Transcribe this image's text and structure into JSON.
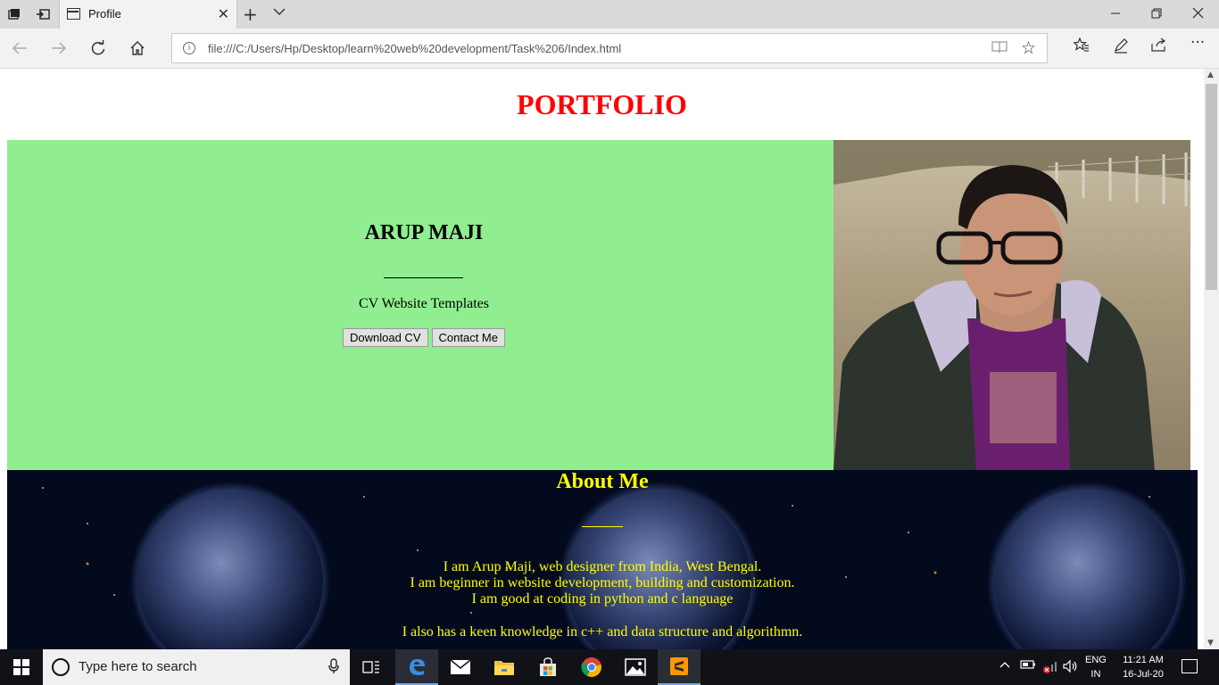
{
  "browser": {
    "tab_title": "Profile",
    "url": "file:///C:/Users/Hp/Desktop/learn%20web%20development/Task%206/Index.html",
    "window_controls": [
      "minimize",
      "restore",
      "close"
    ]
  },
  "page": {
    "heading": "PORTFOLIO",
    "hero": {
      "name": "ARUP MAJI",
      "subtitle": "CV Website Templates",
      "buttons": {
        "download": "Download CV",
        "contact": "Contact Me"
      },
      "background_color": "#90ee90"
    },
    "about": {
      "title": "About Me",
      "lines": [
        "I am Arup Maji, web designer from India, West Bengal.",
        "I am beginner in website development, building and customization.",
        "I am good at coding in python and c language",
        "I also has a keen knowledge in c++ and data structure and algorithmn."
      ],
      "text_color": "#ffff00"
    },
    "heading_color": "#ff0000"
  },
  "taskbar": {
    "search_placeholder": "Type here to search",
    "apps": [
      "task-view",
      "edge",
      "mail",
      "file-explorer",
      "store",
      "chrome",
      "photos",
      "sublime-text"
    ],
    "lang_top": "ENG",
    "lang_bottom": "IN",
    "time": "11:21 AM",
    "date": "16-Jul-20"
  }
}
